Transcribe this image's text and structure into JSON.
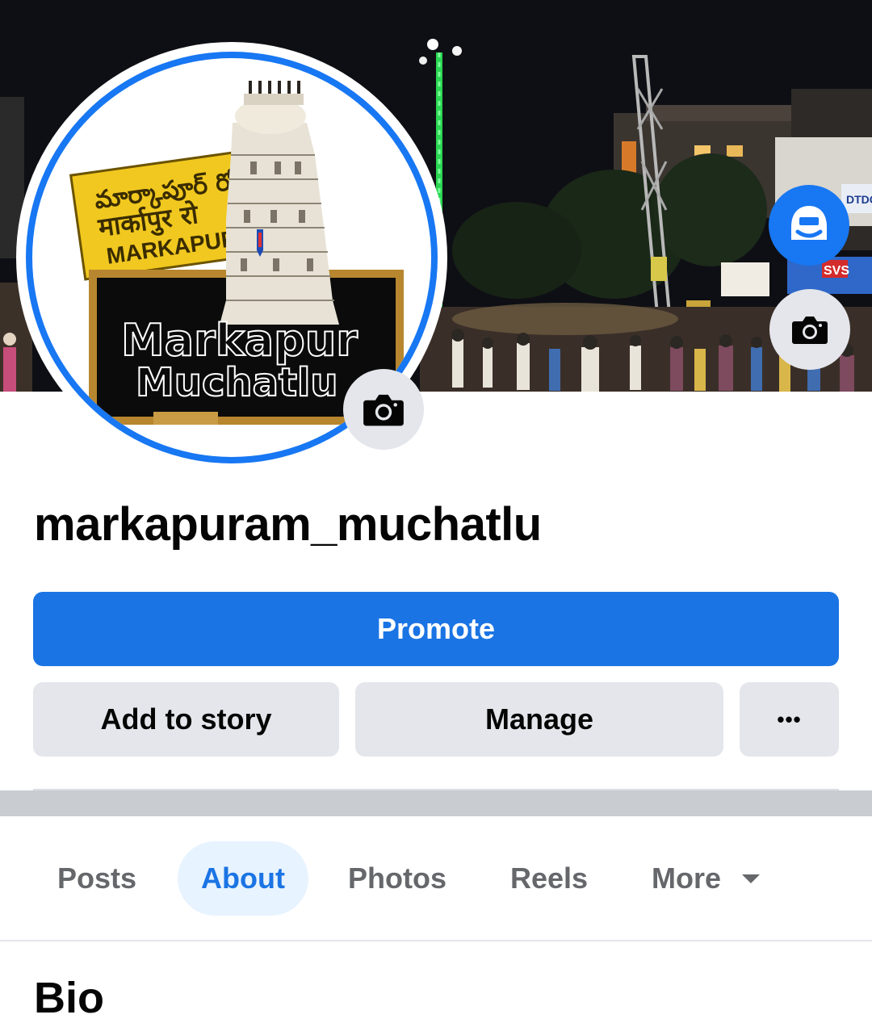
{
  "page": {
    "name": "markapuram_muchatlu"
  },
  "profile_picture": {
    "sign_telugu": "మార్కాపూర్ రోడ్",
    "sign_hindi": "मार्कापुर रो",
    "sign_english": "MARKAPUR R",
    "board_line1": "Markapur",
    "board_line2": "Muchatlu"
  },
  "actions": {
    "promote_label": "Promote",
    "add_story_label": "Add to story",
    "manage_label": "Manage",
    "more_label": "•••"
  },
  "tabs": [
    {
      "label": "Posts",
      "active": false
    },
    {
      "label": "About",
      "active": true
    },
    {
      "label": "Photos",
      "active": false
    },
    {
      "label": "Reels",
      "active": false
    },
    {
      "label": "More",
      "active": false
    }
  ],
  "section": {
    "title": "Bio"
  },
  "cover_signs": {
    "dtdc": "DTDC",
    "svs": "SVS"
  },
  "icons": {
    "avatar_camera": "camera-icon",
    "cover_camera": "camera-icon",
    "switch_profile": "avatar-switch-icon",
    "more_dropdown": "caret-down-icon"
  },
  "colors": {
    "accent": "#1b74e4",
    "secondary_button": "#e4e6eb",
    "active_tab_bg": "#e7f3ff",
    "muted_text": "#65676b"
  }
}
